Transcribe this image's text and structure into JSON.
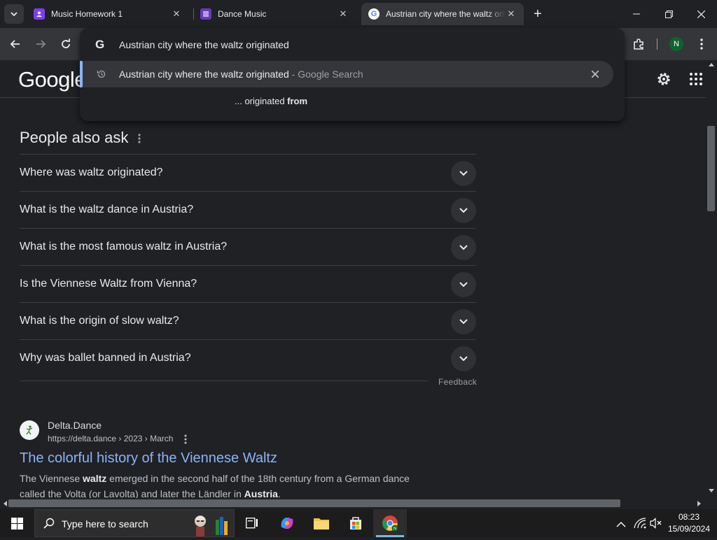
{
  "tabs": [
    {
      "title": "Music Homework 1",
      "favicon_color": "#7e3ff2"
    },
    {
      "title": "Dance Music",
      "favicon_color": "#673ab7"
    },
    {
      "title": "Austrian city where the waltz origina",
      "favicon": "google-icon",
      "active": true
    }
  ],
  "toolbar": {
    "profile_initial": "N"
  },
  "omnibox": {
    "input_value": "Austrian city where the waltz originated",
    "suggestion_main": "Austrian city where the waltz originated",
    "suggestion_suffix": " - Google Search",
    "suggestion2_prefix": "... originated ",
    "suggestion2_bold": "from"
  },
  "google": {
    "logo_text": "Google"
  },
  "paa": {
    "title": "People also ask",
    "questions": [
      "Where was waltz originated?",
      "What is the waltz dance in Austria?",
      "What is the most famous waltz in Austria?",
      "Is the Viennese Waltz from Vienna?",
      "What is the origin of slow waltz?",
      "Why was ballet banned in Austria?"
    ],
    "feedback": "Feedback"
  },
  "result": {
    "site": "Delta.Dance",
    "url": "https://delta.dance › 2023 › March",
    "title": "The colorful history of the Viennese Waltz",
    "snippet_1a": "The Viennese ",
    "snippet_1b": "waltz",
    "snippet_1c": " emerged in the second half of the 18th century from a German dance",
    "snippet_2a": "called the Volta (or Lavolta) and later the Ländler in ",
    "snippet_2b": "Austria",
    "snippet_2c": "."
  },
  "taskbar": {
    "search_placeholder": "Type here to search",
    "time": "08:23",
    "date": "15/09/2024"
  },
  "colors": {
    "link": "#8ab4f8",
    "accent": "#8ab4f8",
    "background": "#202124"
  }
}
